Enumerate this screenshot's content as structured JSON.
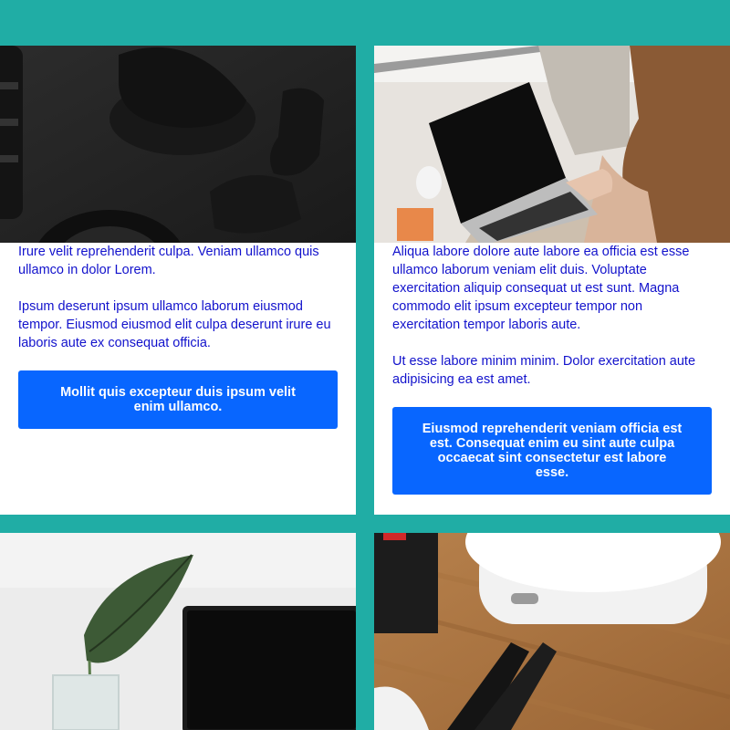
{
  "cards": [
    {
      "image": "camera-gear-photo",
      "paragraphs": [
        "Irure velit reprehenderit culpa. Veniam ullamco quis ullamco in dolor Lorem.",
        "Ipsum deserunt ipsum ullamco laborum eiusmod tempor. Eiusmod eiusmod elit culpa deserunt irure eu laboris aute ex consequat officia."
      ],
      "button_label": "Mollit quis excepteur duis ipsum velit enim ullamco."
    },
    {
      "image": "laptop-woman-photo",
      "paragraphs": [
        "Aliqua labore dolore aute labore ea officia est esse ullamco laborum veniam elit duis. Voluptate exercitation aliquip consequat ut est sunt. Magna commodo elit ipsum excepteur tempor non exercitation tempor laboris aute.",
        "Ut esse labore minim minim. Dolor exercitation aute adipisicing ea est amet."
      ],
      "button_label": "Eiusmod reprehenderit veniam officia est est. Consequat enim eu sint aute culpa occaecat sint consectetur est labore esse."
    },
    {
      "image": "plant-laptop-photo"
    },
    {
      "image": "earbuds-case-photo"
    }
  ],
  "colors": {
    "background": "#20ada5",
    "text": "#1212cc",
    "button": "#0866ff"
  }
}
